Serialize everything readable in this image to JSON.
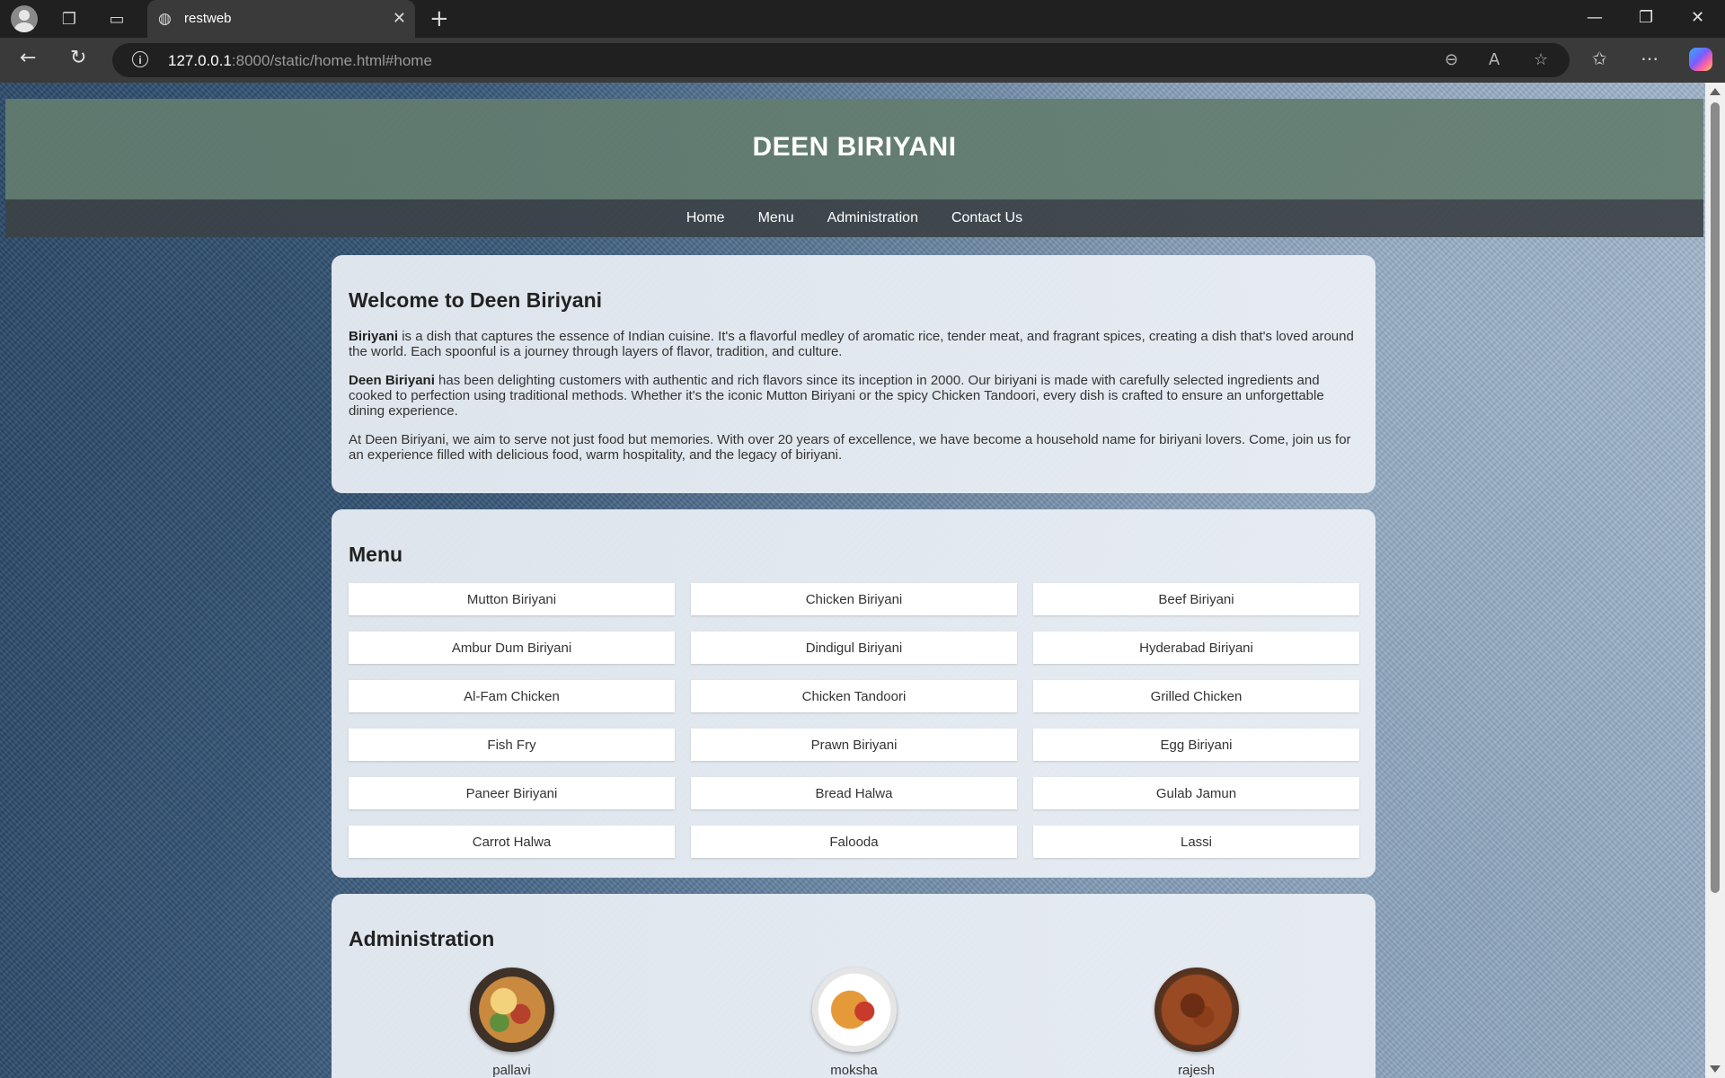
{
  "browser": {
    "tab_title": "restweb",
    "url_host": "127.0.0.1",
    "url_rest": ":8000/static/home.html#home"
  },
  "site": {
    "title": "DEEN BIRIYANI",
    "nav": [
      "Home",
      "Menu",
      "Administration",
      "Contact Us"
    ]
  },
  "welcome": {
    "heading": "Welcome to Deen Biriyani",
    "p1_bold": "Biriyani",
    "p1_text": " is a dish that captures the essence of Indian cuisine. It's a flavorful medley of aromatic rice, tender meat, and fragrant spices, creating a dish that's loved around the world. Each spoonful is a journey through layers of flavor, tradition, and culture.",
    "p2_bold": "Deen Biriyani",
    "p2_text": " has been delighting customers with authentic and rich flavors since its inception in 2000. Our biriyani is made with carefully selected ingredients and cooked to perfection using traditional methods. Whether it's the iconic Mutton Biriyani or the spicy Chicken Tandoori, every dish is crafted to ensure an unforgettable dining experience.",
    "p3_text": "At Deen Biriyani, we aim to serve not just food but memories. With over 20 years of excellence, we have become a household name for biriyani lovers. Come, join us for an experience filled with delicious food, warm hospitality, and the legacy of biriyani."
  },
  "menu": {
    "heading": "Menu",
    "items": [
      "Mutton Biriyani",
      "Chicken Biriyani",
      "Beef Biriyani",
      "Ambur Dum Biriyani",
      "Dindigul Biriyani",
      "Hyderabad Biriyani",
      "Al-Fam Chicken",
      "Chicken Tandoori",
      "Grilled Chicken",
      "Fish Fry",
      "Prawn Biriyani",
      "Egg Biriyani",
      "Paneer Biriyani",
      "Bread Halwa",
      "Gulab Jamun",
      "Carrot Halwa",
      "Falooda",
      "Lassi"
    ]
  },
  "administration": {
    "heading": "Administration",
    "people": [
      "pallavi",
      "moksha",
      "rajesh"
    ]
  }
}
